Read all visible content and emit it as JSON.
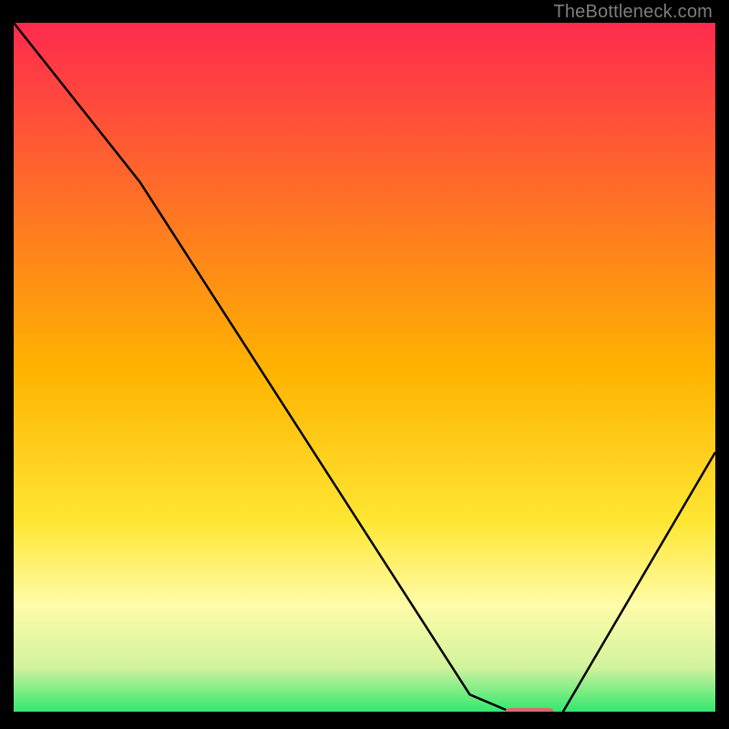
{
  "watermark": "TheBottleneck.com",
  "chart_data": {
    "type": "line",
    "title": "",
    "xlabel": "",
    "ylabel": "",
    "xlim": [
      0,
      100
    ],
    "ylim": [
      0,
      100
    ],
    "x": [
      0,
      18,
      65,
      72,
      78,
      100
    ],
    "values": [
      100,
      77,
      3,
      0,
      0,
      38
    ],
    "marker": {
      "x_start": 70,
      "x_end": 77,
      "y": 0,
      "color": "#d96a6f"
    },
    "gradient_stops": [
      {
        "offset": 0.0,
        "color": "#ff2a4e"
      },
      {
        "offset": 0.5,
        "color": "#ffb300"
      },
      {
        "offset": 0.72,
        "color": "#ffe633"
      },
      {
        "offset": 0.84,
        "color": "#fffca8"
      },
      {
        "offset": 0.93,
        "color": "#d3f39e"
      },
      {
        "offset": 1.0,
        "color": "#26e66b"
      }
    ],
    "curve_color": "#000000",
    "axis_color": "#000000"
  }
}
